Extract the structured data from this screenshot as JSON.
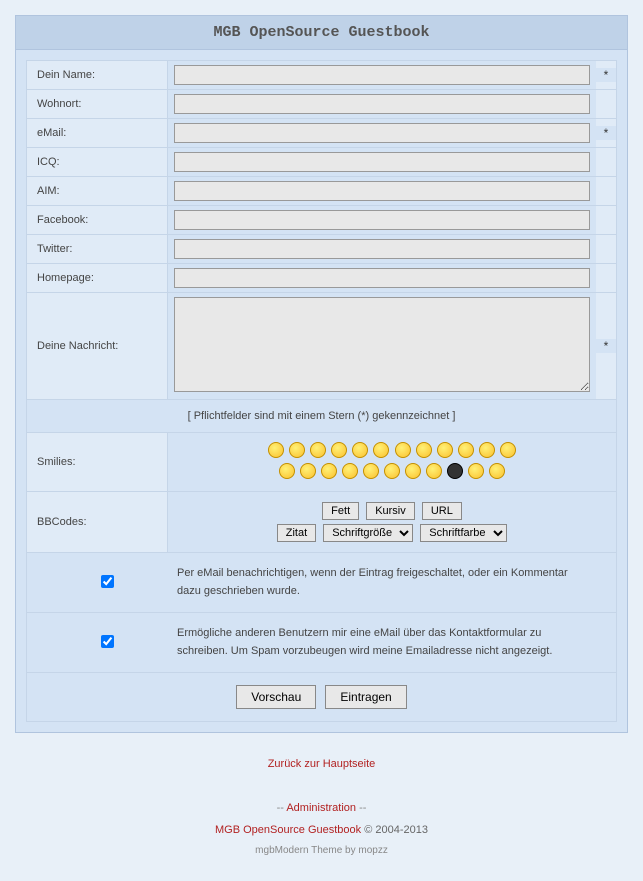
{
  "header": {
    "title": "MGB OpenSource Guestbook"
  },
  "fields": {
    "name": {
      "label": "Dein Name:",
      "required": "*"
    },
    "location": {
      "label": "Wohnort:",
      "required": ""
    },
    "email": {
      "label": "eMail:",
      "required": "*"
    },
    "icq": {
      "label": "ICQ:",
      "required": ""
    },
    "aim": {
      "label": "AIM:",
      "required": ""
    },
    "facebook": {
      "label": "Facebook:",
      "required": ""
    },
    "twitter": {
      "label": "Twitter:",
      "required": ""
    },
    "homepage": {
      "label": "Homepage:",
      "required": ""
    },
    "message": {
      "label": "Deine Nachricht:",
      "required": "*"
    }
  },
  "note": "[ Pflichtfelder sind mit einem Stern (*) gekennzeichnet ]",
  "smilies": {
    "label": "Smilies:"
  },
  "bbcodes": {
    "label": "BBCodes:",
    "bold": "Fett",
    "italic": "Kursiv",
    "url": "URL",
    "quote": "Zitat",
    "fontsize": "Schriftgröße",
    "fontcolor": "Schriftfarbe"
  },
  "checkboxes": {
    "notify": "Per eMail benachrichtigen, wenn der Eintrag freigeschaltet, oder ein Kommentar dazu geschrieben wurde.",
    "contact": "Ermögliche anderen Benutzern mir eine eMail über das Kontaktformular zu schreiben. Um Spam vorzubeugen wird meine Emailadresse nicht angezeigt."
  },
  "buttons": {
    "preview": "Vorschau",
    "submit": "Eintragen"
  },
  "footer": {
    "back": "Zurück zur Hauptseite",
    "admin": "Administration",
    "product": "MGB OpenSource Guestbook",
    "copyright": " © 2004-2013",
    "theme": "mgbModern Theme by mopzz"
  }
}
